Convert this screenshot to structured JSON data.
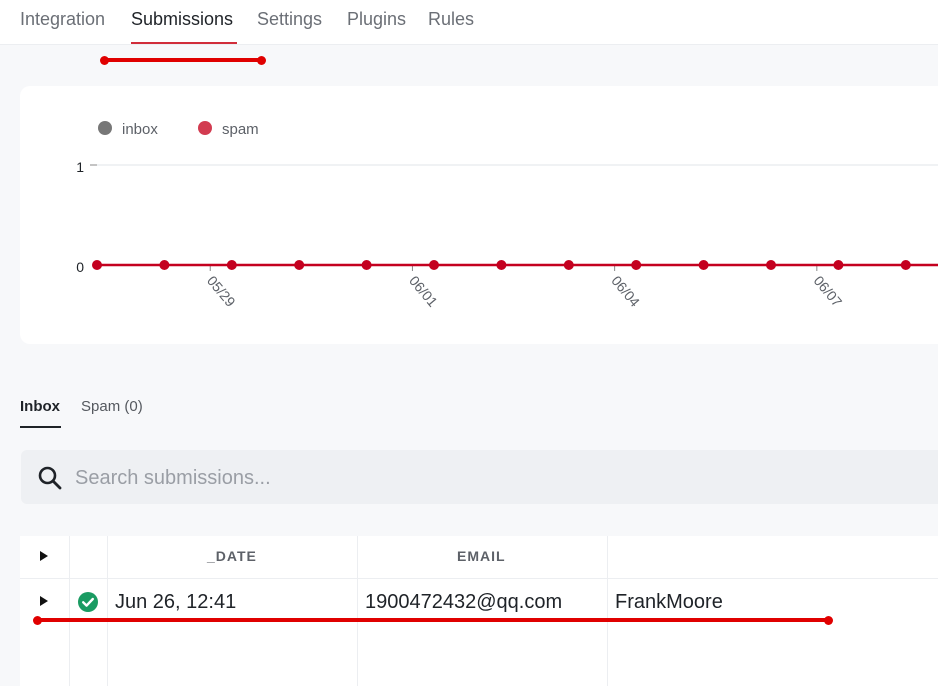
{
  "nav": {
    "tabs": [
      {
        "label": "Integration"
      },
      {
        "label": "Submissions"
      },
      {
        "label": "Settings"
      },
      {
        "label": "Plugins"
      },
      {
        "label": "Rules"
      }
    ],
    "active": "Submissions"
  },
  "chart_data": {
    "type": "line",
    "legend": [
      "inbox",
      "spam"
    ],
    "legend_position": "top-left",
    "x_ticks": [
      "05/29",
      "06/01",
      "06/04",
      "06/07"
    ],
    "y_ticks": [
      "0",
      "1"
    ],
    "ylim": [
      0,
      1
    ],
    "grid": true,
    "colors": {
      "inbox": "#777777",
      "spam": "#d23b50",
      "line": "#c4001f"
    },
    "series": [
      {
        "name": "inbox",
        "values": [
          0,
          0,
          0,
          0,
          0,
          0,
          0,
          0,
          0,
          0,
          0,
          0,
          0,
          0
        ]
      },
      {
        "name": "spam",
        "values": [
          0,
          0,
          0,
          0,
          0,
          0,
          0,
          0,
          0,
          0,
          0,
          0,
          0,
          0
        ]
      }
    ]
  },
  "subtabs": {
    "inbox": "Inbox",
    "spam": "Spam (0)"
  },
  "search": {
    "placeholder": "Search submissions..."
  },
  "table": {
    "columns": [
      "_DATE",
      "EMAIL"
    ],
    "rows": [
      {
        "date": "Jun 26, 12:41",
        "email": "1900472432@qq.com",
        "name": "FrankMoore"
      }
    ]
  }
}
